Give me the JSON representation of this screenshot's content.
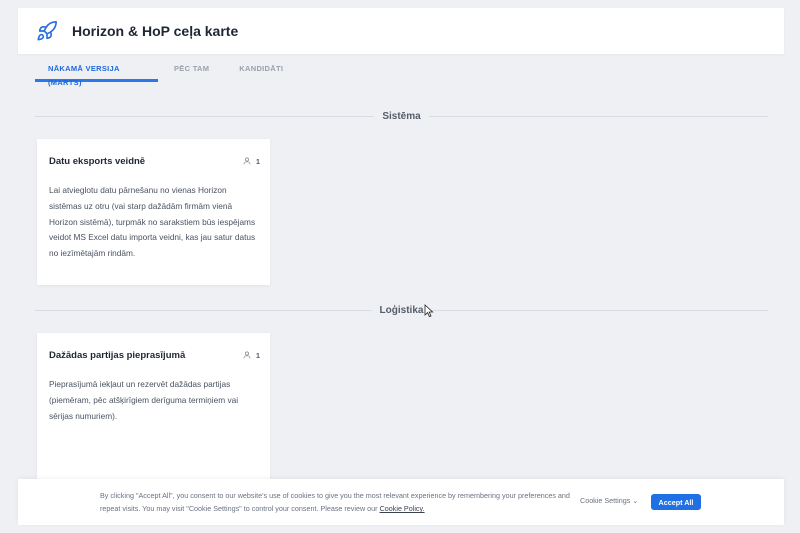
{
  "header": {
    "title": "Horizon & HoP ceļa karte",
    "logo_icon": "rocket-icon"
  },
  "tabs": [
    {
      "label": "NĀKAMĀ VERSIJA (MARTS)",
      "active": true
    },
    {
      "label": "PĒC TAM",
      "active": false
    },
    {
      "label": "KANDIDĀTI",
      "active": false
    }
  ],
  "sections": [
    {
      "title": "Sistēma",
      "card": {
        "title": "Datu eksports veidnē",
        "votes": "1",
        "body": "Lai atvieglotu datu pārnešanu no vienas Horizon sistēmas uz otru (vai starp dažādām firmām vienā Horizon sistēmā), turpmāk no sarakstiem būs iespējams veidot MS Excel datu importa veidni, kas jau satur datus no iezīmētajām rindām."
      }
    },
    {
      "title": "Loģistika",
      "card": {
        "title": "Dažādas partijas pieprasījumā",
        "votes": "1",
        "body": "Pieprasījumā iekļaut un rezervēt dažādas partijas (piemēram, pēc atšķirīgiem derīguma termiņiem vai sērijas numuriem)."
      }
    }
  ],
  "cookie_bar": {
    "text": "By clicking \"Accept All\", you consent to our website's use of cookies to give you the most relevant experience by remembering your preferences and repeat visits. You may visit \"Cookie Settings\" to control your consent. Please review our ",
    "policy_link": "Cookie Policy.",
    "settings_label": "Cookie Settings",
    "accept_label": "Accept All"
  },
  "colors": {
    "accent": "#1f6fe5",
    "background": "#eef0f4"
  }
}
